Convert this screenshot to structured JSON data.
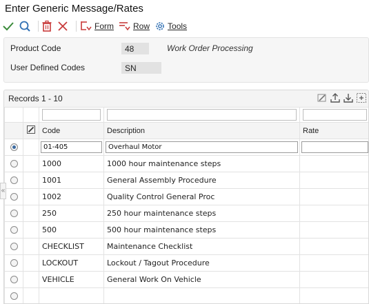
{
  "title": "Enter Generic Message/Rates",
  "toolbar": {
    "form_label": "Form",
    "row_label": "Row",
    "tools_label": "Tools"
  },
  "header": {
    "product_code_label": "Product Code",
    "product_code_value": "48",
    "product_code_desc": "Work Order Processing",
    "udc_label": "User Defined Codes",
    "udc_value": "SN"
  },
  "grid": {
    "records_label": "Records 1 - 10",
    "columns": {
      "code": "Code",
      "description": "Description",
      "rate": "Rate"
    },
    "rows": [
      {
        "code": "01-405",
        "description": "Overhaul Motor",
        "rate": "",
        "selected": true
      },
      {
        "code": "1000",
        "description": "1000 hour maintenance steps",
        "rate": ""
      },
      {
        "code": "1001",
        "description": "General Assembly Procedure",
        "rate": ""
      },
      {
        "code": "1002",
        "description": "Quality Control General Proc",
        "rate": ""
      },
      {
        "code": "250",
        "description": "250 hour maintenance steps",
        "rate": ""
      },
      {
        "code": "500",
        "description": "500 hour maintenance steps",
        "rate": ""
      },
      {
        "code": "CHECKLIST",
        "description": "Maintenance Checklist",
        "rate": ""
      },
      {
        "code": "LOCKOUT",
        "description": "Lockout / Tagout Procedure",
        "rate": ""
      },
      {
        "code": "VEHICLE",
        "description": "General Work On Vehicle",
        "rate": ""
      },
      {
        "code": "",
        "description": "",
        "rate": ""
      }
    ]
  },
  "colors": {
    "accent_green": "#3a8b3a",
    "accent_blue": "#2f6fb3",
    "delete_red": "#c83a3a"
  },
  "icons": [
    "check-icon",
    "search-icon",
    "trash-icon",
    "close-x-icon",
    "form-menu-icon",
    "row-menu-icon",
    "gear-icon",
    "edit-grid-icon",
    "export-icon",
    "import-icon",
    "expand-icon",
    "collapse-left-icon"
  ]
}
